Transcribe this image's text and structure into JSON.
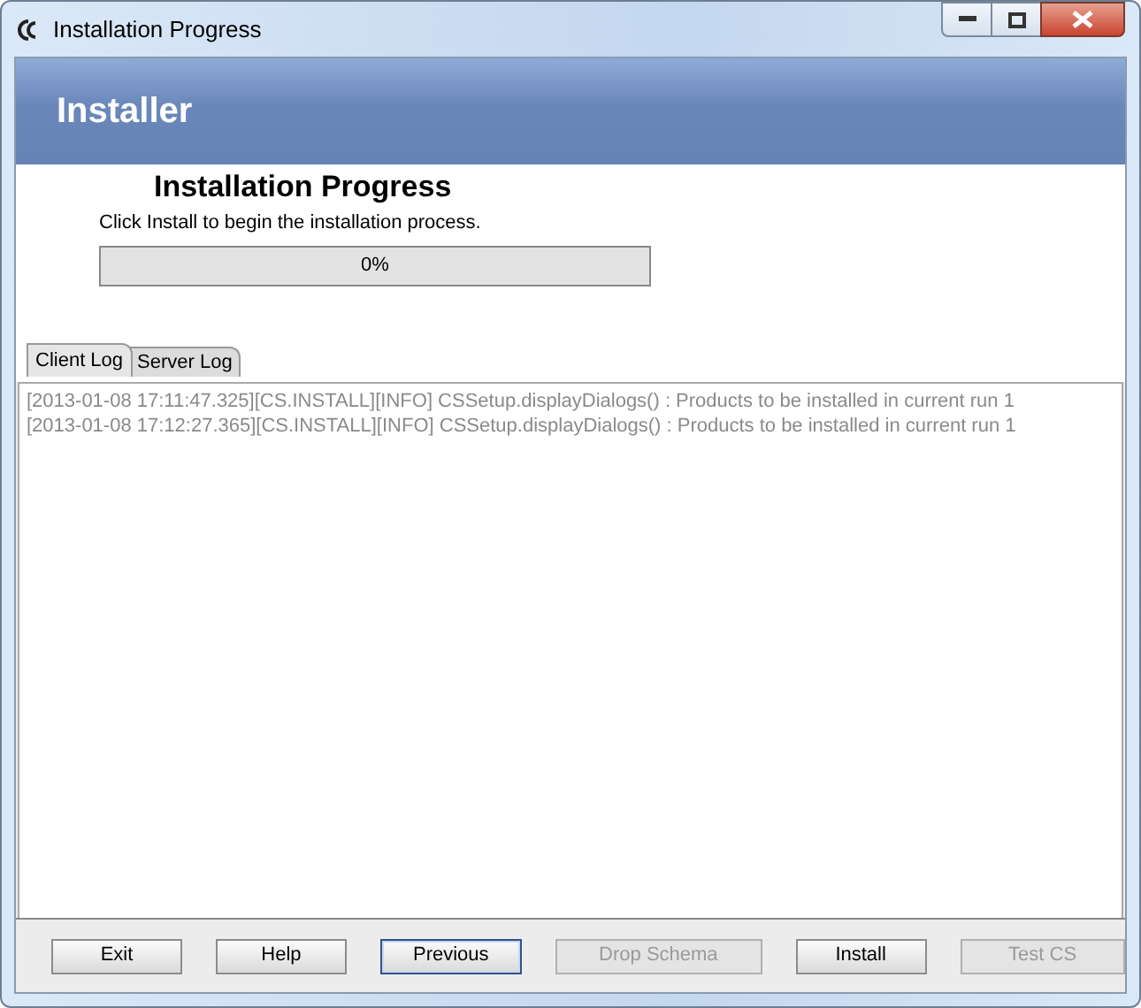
{
  "window": {
    "title": "Installation Progress"
  },
  "header": {
    "title": "Installer"
  },
  "heading": "Installation Progress",
  "instruction": "Click Install to begin the installation process.",
  "progress": {
    "level": 0,
    "reading": "0%"
  },
  "tabs": [
    {
      "label": "Client Log",
      "selected": true
    },
    {
      "label": "Server Log",
      "selected": false
    }
  ],
  "log_lines": [
    "[2013-01-08 17:11:47.325][CS.INSTALL][INFO] CSSetup.displayDialogs() : Products to be installed in current run 1",
    "[2013-01-08 17:12:27.365][CS.INSTALL][INFO] CSSetup.displayDialogs() : Products to be installed in current run 1"
  ],
  "buttons": [
    {
      "label": "Exit",
      "disabled": false,
      "focused": false
    },
    {
      "label": "Help",
      "disabled": false,
      "focused": false
    },
    {
      "label": "Previous",
      "disabled": false,
      "focused": true
    },
    {
      "label": "Drop Schema",
      "disabled": true,
      "focused": false
    },
    {
      "label": "Install",
      "disabled": false,
      "focused": false
    },
    {
      "label": "Test CS",
      "disabled": true,
      "focused": false
    }
  ]
}
